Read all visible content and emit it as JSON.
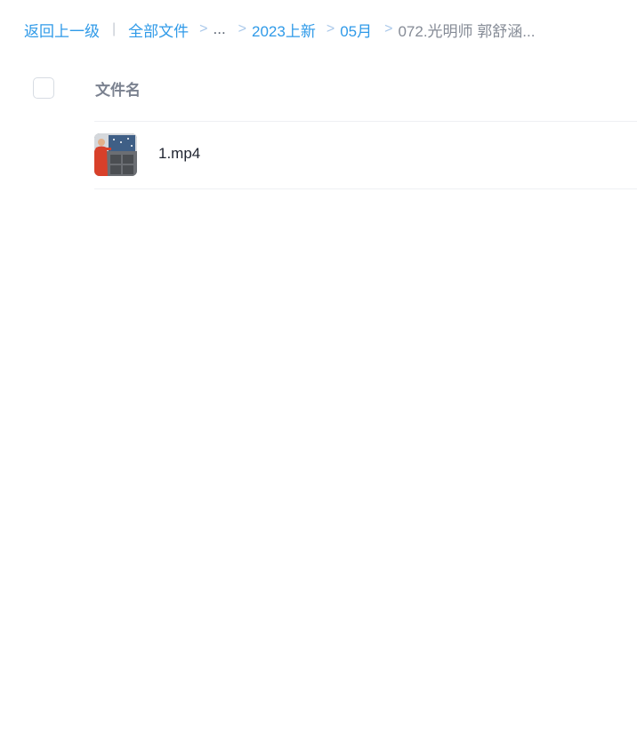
{
  "breadcrumb": {
    "back_label": "返回上一级",
    "divider": "|",
    "root_label": "全部文件",
    "separator": ">",
    "ellipsis": "...",
    "items": [
      "2023上新",
      "05月"
    ],
    "current": "072.光明师 郭舒涵..."
  },
  "file_list": {
    "column_name": "文件名",
    "files": [
      {
        "name": "1.mp4",
        "thumbnail": "video-thumbnail"
      }
    ]
  },
  "colors": {
    "link": "#2f9ae8",
    "current": "#858b96",
    "separator": "#a9c8ea",
    "header_text": "#7b8290",
    "file_text": "#1f2430"
  }
}
